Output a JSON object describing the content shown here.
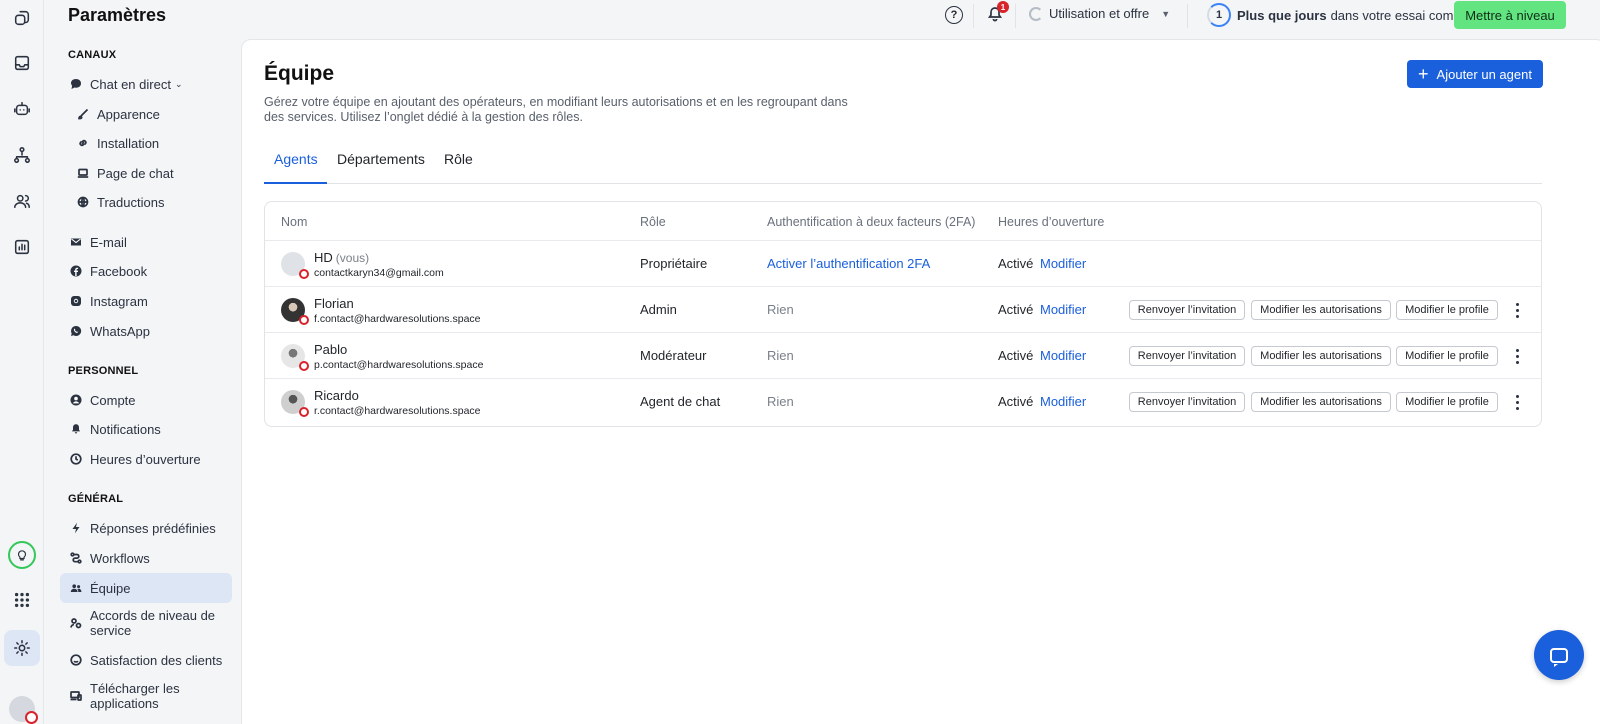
{
  "sidebar": {
    "title": "Paramètres",
    "sections": {
      "channels": "CANAUX",
      "personal": "PERSONNEL",
      "general": "GÉNÉRAL"
    },
    "channels": [
      {
        "label": "Chat en direct",
        "icon": "chat-bubble-icon"
      },
      {
        "label": "Apparence",
        "icon": "brush-icon"
      },
      {
        "label": "Installation",
        "icon": "link-icon"
      },
      {
        "label": "Page de chat",
        "icon": "laptop-icon"
      },
      {
        "label": "Traductions",
        "icon": "globe-icon"
      },
      {
        "label": "E-mail",
        "icon": "mail-icon"
      },
      {
        "label": "Facebook",
        "icon": "facebook-icon"
      },
      {
        "label": "Instagram",
        "icon": "instagram-icon"
      },
      {
        "label": "WhatsApp",
        "icon": "whatsapp-icon"
      }
    ],
    "personal": [
      {
        "label": "Compte",
        "icon": "user-circle-icon"
      },
      {
        "label": "Notifications",
        "icon": "bell-icon"
      },
      {
        "label": "Heures d’ouverture",
        "icon": "clock-icon"
      }
    ],
    "general": [
      {
        "label": "Réponses prédéfinies",
        "icon": "bolt-icon"
      },
      {
        "label": "Workflows",
        "icon": "workflow-icon"
      },
      {
        "label": "Équipe",
        "icon": "team-icon",
        "active": true
      },
      {
        "label": "Accords de niveau de service",
        "icon": "sla-icon"
      },
      {
        "label": "Satisfaction des clients",
        "icon": "smile-icon"
      },
      {
        "label": "Télécharger les applications",
        "icon": "devices-icon"
      }
    ]
  },
  "topbar": {
    "notification_count": "1",
    "usage_label": "Utilisation et offre",
    "trial_days": "1",
    "trial_bold": "Plus que jours",
    "trial_text": "dans votre essai complet",
    "upgrade_label": "Mettre à niveau"
  },
  "main": {
    "title": "Équipe",
    "description": "Gérez votre équipe en ajoutant des opérateurs, en modifiant leurs autorisations et en les regroupant dans des services. Utilisez l’onglet dédié à la gestion des rôles.",
    "add_button": "Ajouter un agent",
    "tabs": [
      {
        "label": "Agents",
        "active": true
      },
      {
        "label": "Départements"
      },
      {
        "label": "Rôle"
      }
    ],
    "columns": {
      "name": "Nom",
      "role": "Rôle",
      "twofa": "Authentification à deux facteurs (2FA)",
      "hours": "Heures d’ouverture"
    },
    "agents": [
      {
        "name": "HD",
        "you": "(vous)",
        "email": "contactkaryn34@gmail.com",
        "role": "Propriétaire",
        "twofa": "Activer l’authentification 2FA",
        "hours": "Activé",
        "modify": "Modifier"
      },
      {
        "name": "Florian",
        "email": "f.contact@hardwaresolutions.space",
        "role": "Admin",
        "twofa": "Rien",
        "hours": "Activé",
        "modify": "Modifier"
      },
      {
        "name": "Pablo",
        "email": "p.contact@hardwaresolutions.space",
        "role": "Modérateur",
        "twofa": "Rien",
        "hours": "Activé",
        "modify": "Modifier"
      },
      {
        "name": "Ricardo",
        "email": "r.contact@hardwaresolutions.space",
        "role": "Agent de chat",
        "twofa": "Rien",
        "hours": "Activé",
        "modify": "Modifier"
      }
    ],
    "row_actions": {
      "resend": "Renvoyer l’invitation",
      "permissions": "Modifier les autorisations",
      "profile": "Modifier le profile"
    }
  },
  "colors": {
    "accent": "#1a5fdc",
    "upgrade": "#62e580",
    "status_offline": "#d8232a",
    "active_nav": "#dce6f5"
  }
}
